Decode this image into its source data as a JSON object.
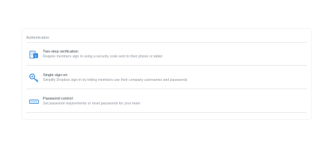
{
  "section": {
    "header": "Authentication"
  },
  "items": [
    {
      "title": "Two-step verification",
      "description": "Require members sign in using a security code sent to their phone or tablet",
      "icon": "phone-verification-icon"
    },
    {
      "title": "Single sign-on",
      "description": "Simplify Dropbox sign-in by letting members use their company usernames and passwords",
      "icon": "key-icon"
    },
    {
      "title": "Password control",
      "description": "Set password requirements or reset passwords for your team",
      "icon": "password-field-icon"
    }
  ],
  "colors": {
    "icon_blue": "#3d8fe0",
    "title": "#3d464d",
    "description": "#8a939c",
    "divider": "#e6e9ec"
  }
}
